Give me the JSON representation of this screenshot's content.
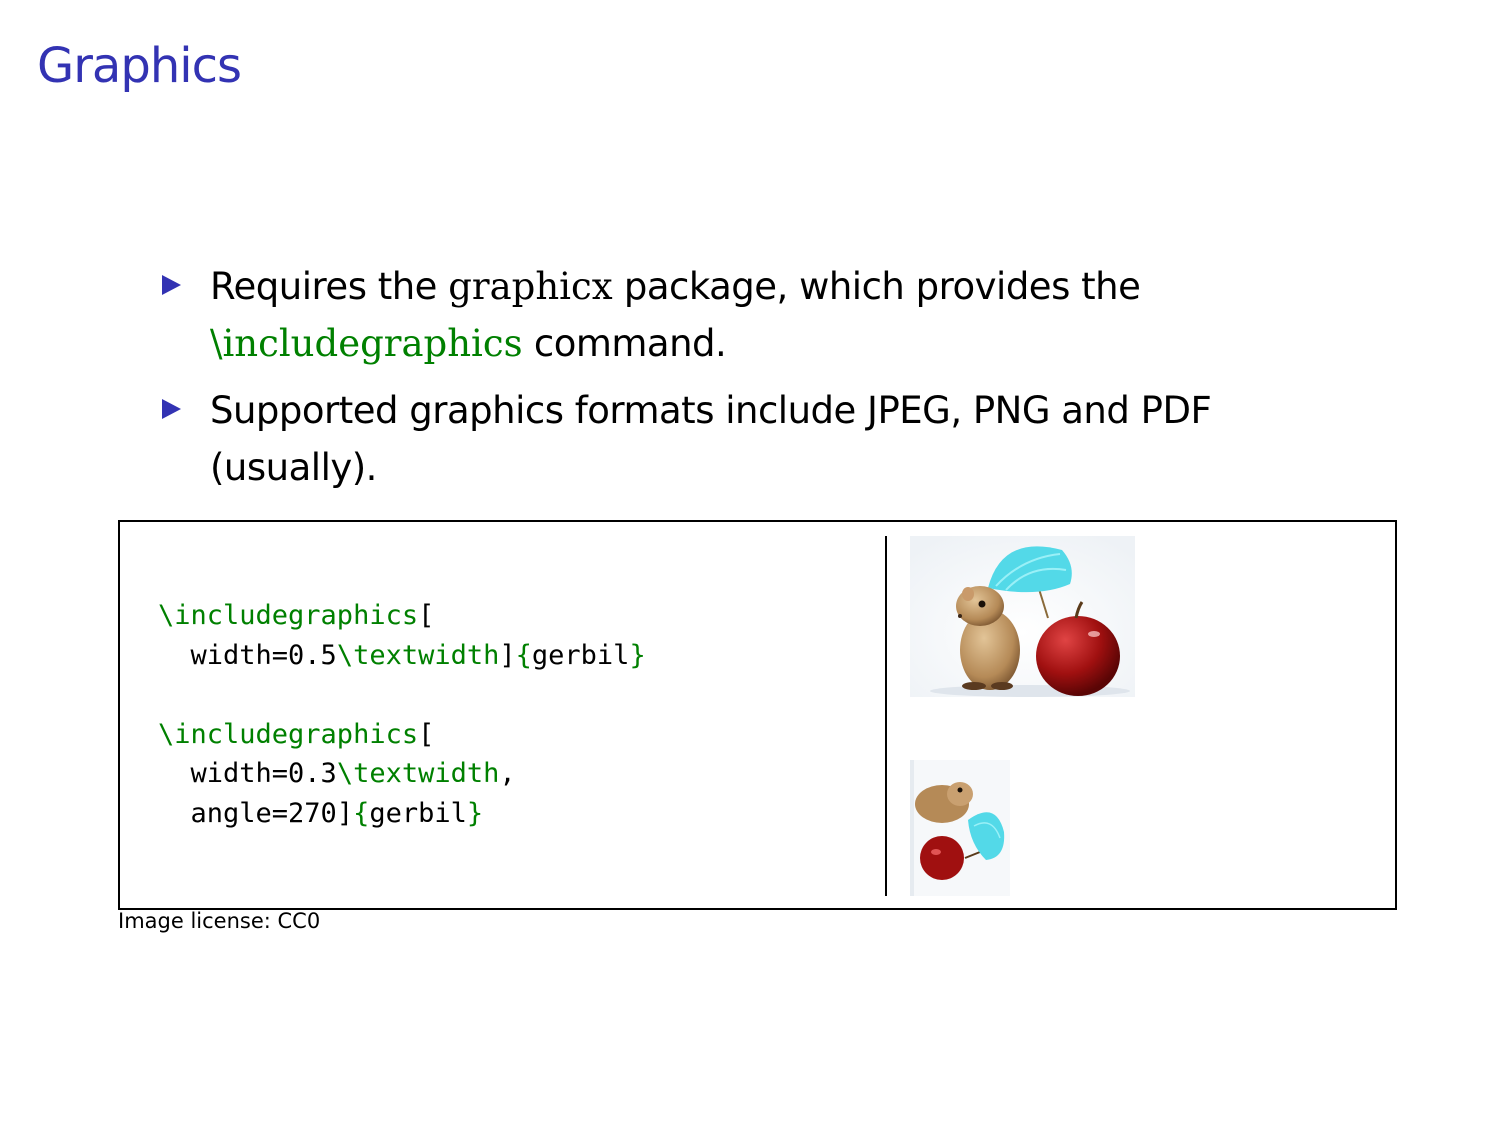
{
  "slide": {
    "title": "Graphics"
  },
  "bullets": [
    {
      "pre": "Requires the ",
      "code1": "graphicx",
      "mid": " package, which provides the ",
      "code2": "\\includegraphics",
      "post": " command."
    },
    {
      "text": "Supported graphics formats include JPEG, PNG and PDF (usually)."
    }
  ],
  "example": {
    "code_block_1": {
      "cmd": "\\includegraphics",
      "open": "[",
      "line2_pre": "  width=0.5",
      "textwidth": "\\textwidth",
      "close": "]",
      "arg_open": "{",
      "arg": "gerbil",
      "arg_close": "}"
    },
    "code_block_2": {
      "cmd": "\\includegraphics",
      "open": "[",
      "line2_pre": "  width=0.3",
      "textwidth": "\\textwidth",
      "comma": ",",
      "line3_pre": "  angle=270",
      "close": "]",
      "arg_open": "{",
      "arg": "gerbil",
      "arg_close": "}"
    },
    "images": [
      {
        "name": "gerbil-with-apple-and-umbrella",
        "rotation_deg": 0
      },
      {
        "name": "gerbil-with-apple-and-umbrella",
        "rotation_deg": 270
      }
    ]
  },
  "caption": "Image license:  CC0",
  "colors": {
    "title": "#3333b3",
    "code_keyword": "#008000",
    "bullet_marker": "#3333b3"
  }
}
